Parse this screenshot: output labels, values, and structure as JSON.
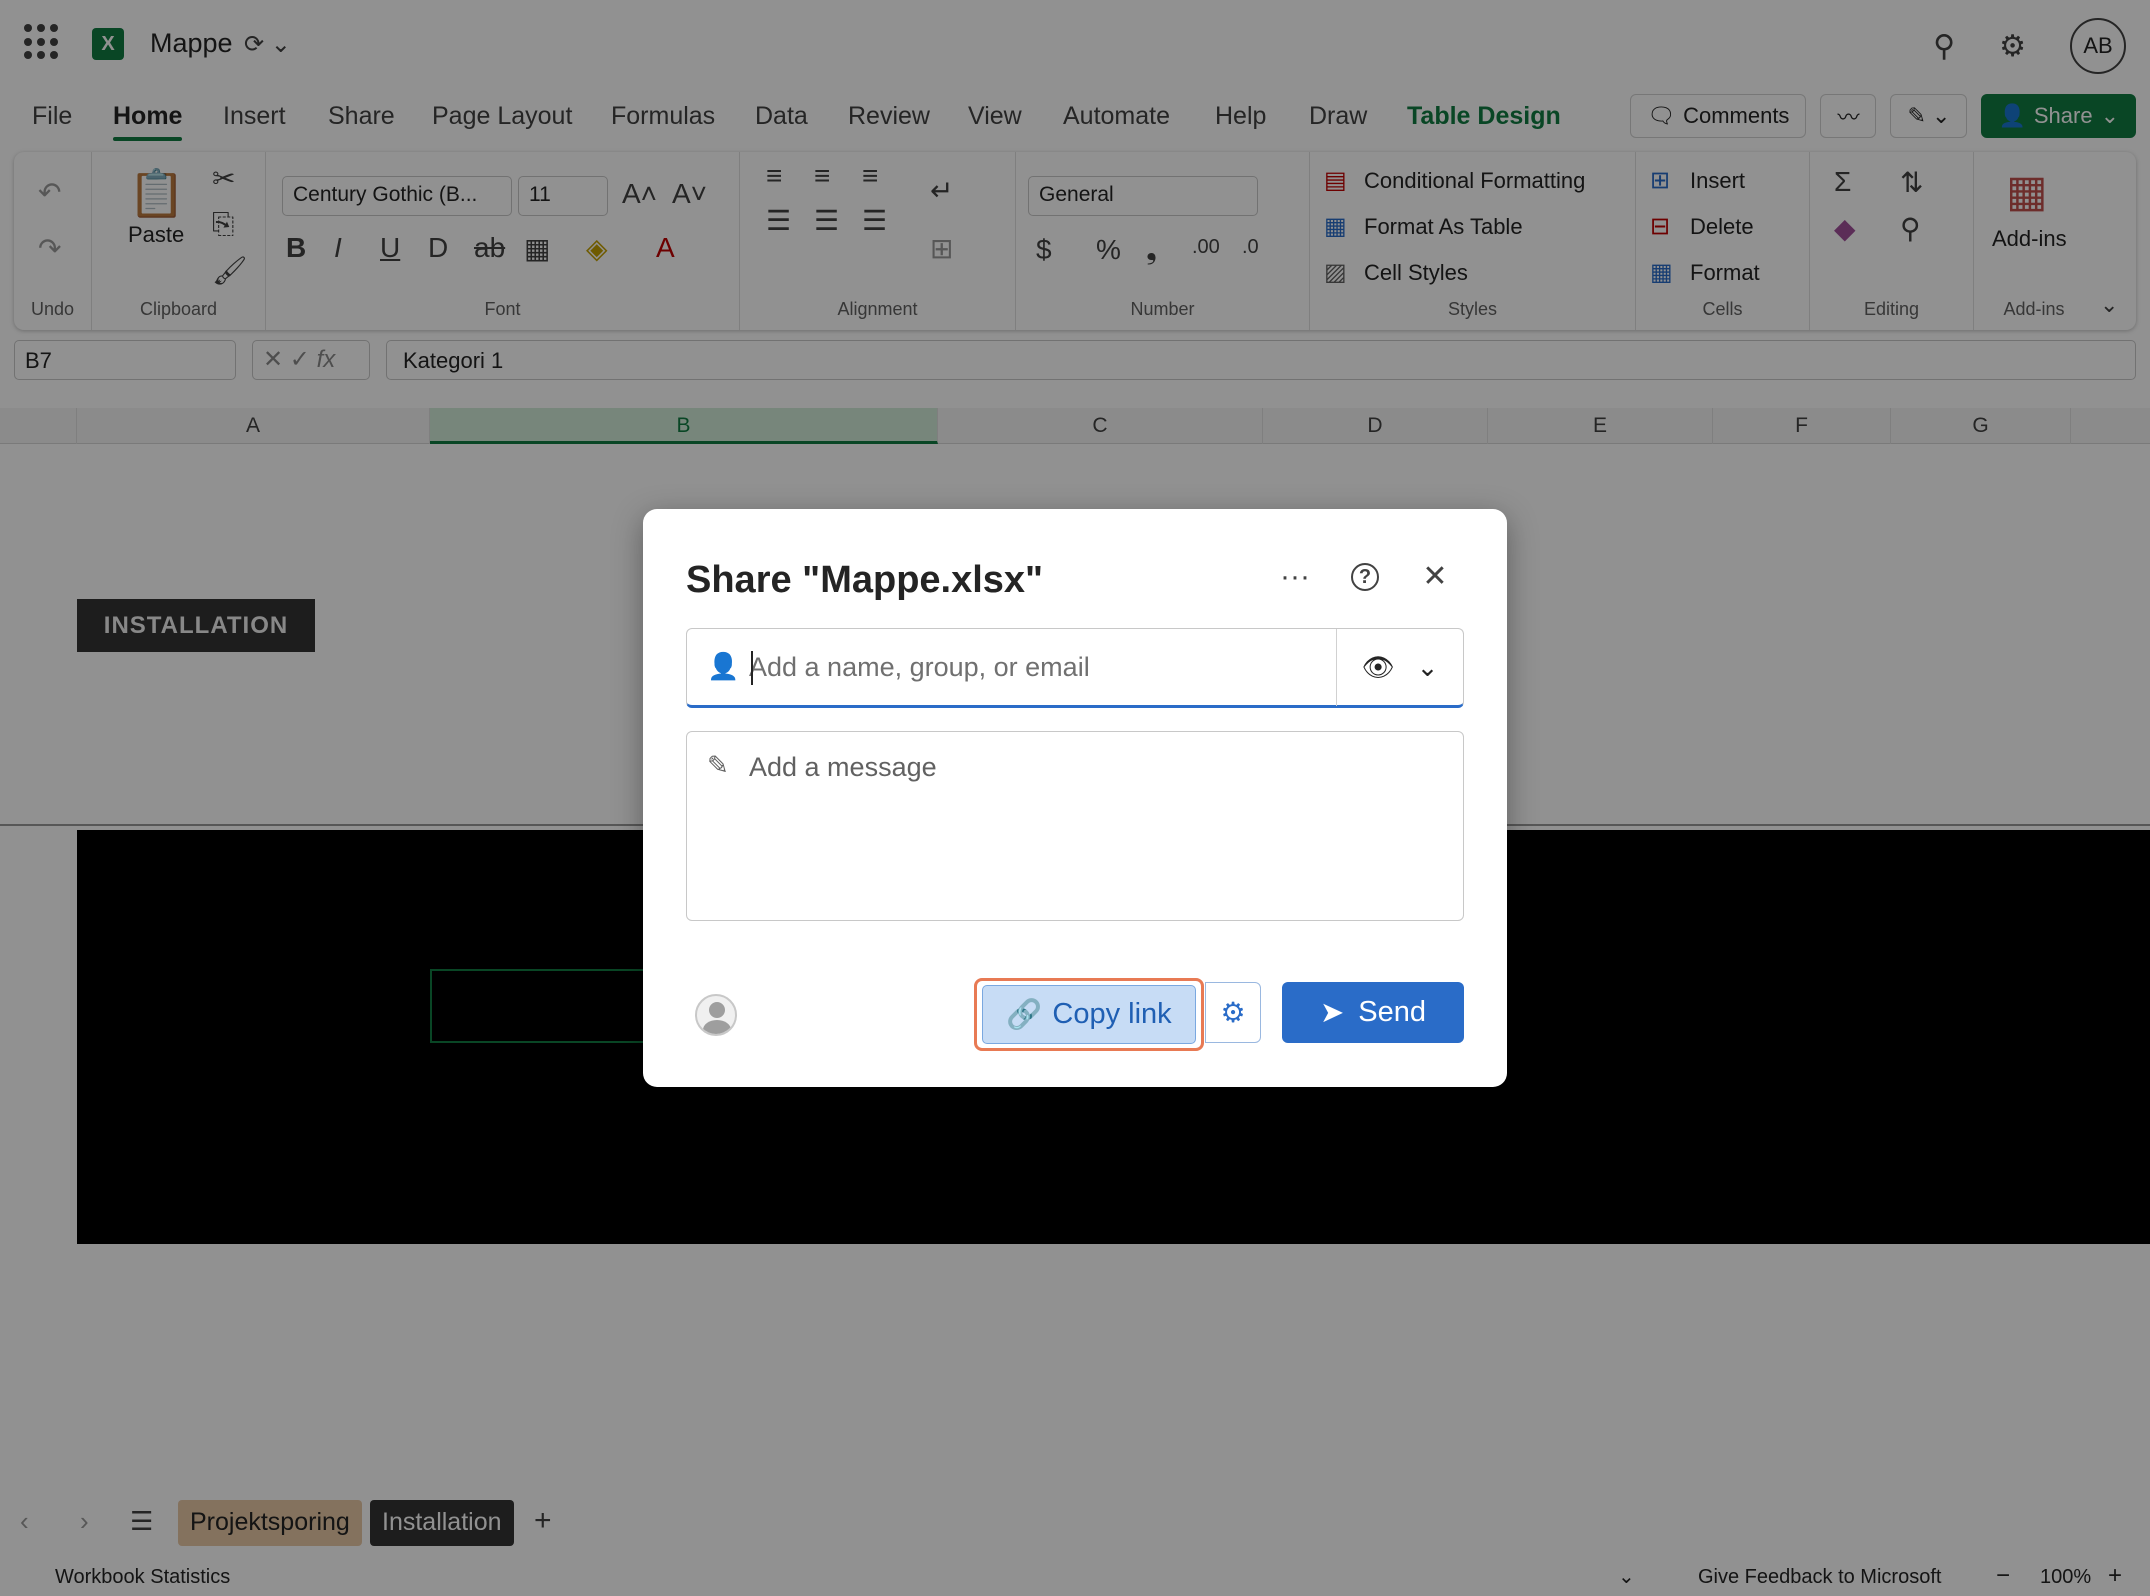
{
  "app": {
    "doc_title": "Mappe",
    "avatar_initials": "AB",
    "brand_color": "#107c41",
    "accent_color": "#2a6cc8"
  },
  "menu": {
    "tabs": [
      "File",
      "Home",
      "Insert",
      "Share",
      "Page Layout",
      "Formulas",
      "Data",
      "Review",
      "View",
      "Automate",
      "Help",
      "Draw",
      "Table Design"
    ],
    "active_tab": "Home",
    "comments_label": "Comments",
    "share_label": "Share"
  },
  "ribbon": {
    "undo_label": "Undo",
    "clipboard_label": "Clipboard",
    "paste_label": "Paste",
    "font_name": "Century Gothic (B...",
    "font_size": "11",
    "font_label": "Font",
    "alignment_label": "Alignment",
    "number_format": "General",
    "number_label": "Number",
    "conditional_formatting": "Conditional Formatting",
    "format_as_table": "Format As Table",
    "cell_styles": "Cell Styles",
    "styles_label": "Styles",
    "insert": "Insert",
    "delete": "Delete",
    "format": "Format",
    "cells_label": "Cells",
    "editing_label": "Editing",
    "addins": "Add-ins",
    "addins_label": "Add-ins"
  },
  "formula_bar": {
    "name_box": "B7",
    "formula": "Kategori 1"
  },
  "grid": {
    "columns": [
      "A",
      "B",
      "C",
      "D",
      "E",
      "F",
      "G"
    ],
    "selected_column": "B",
    "banner_text": "INSTALLATION"
  },
  "sheet_tabs": {
    "tabs": [
      "Projektsporing",
      "Installation"
    ]
  },
  "status": {
    "left": "Workbook Statistics",
    "feedback": "Give Feedback to Microsoft",
    "zoom": "100%"
  },
  "dialog": {
    "title": "Share \"Mappe.xlsx\"",
    "people_placeholder": "Add a name, group, or email",
    "message_placeholder": "Add a message",
    "copy_link_label": "Copy link",
    "send_label": "Send"
  }
}
